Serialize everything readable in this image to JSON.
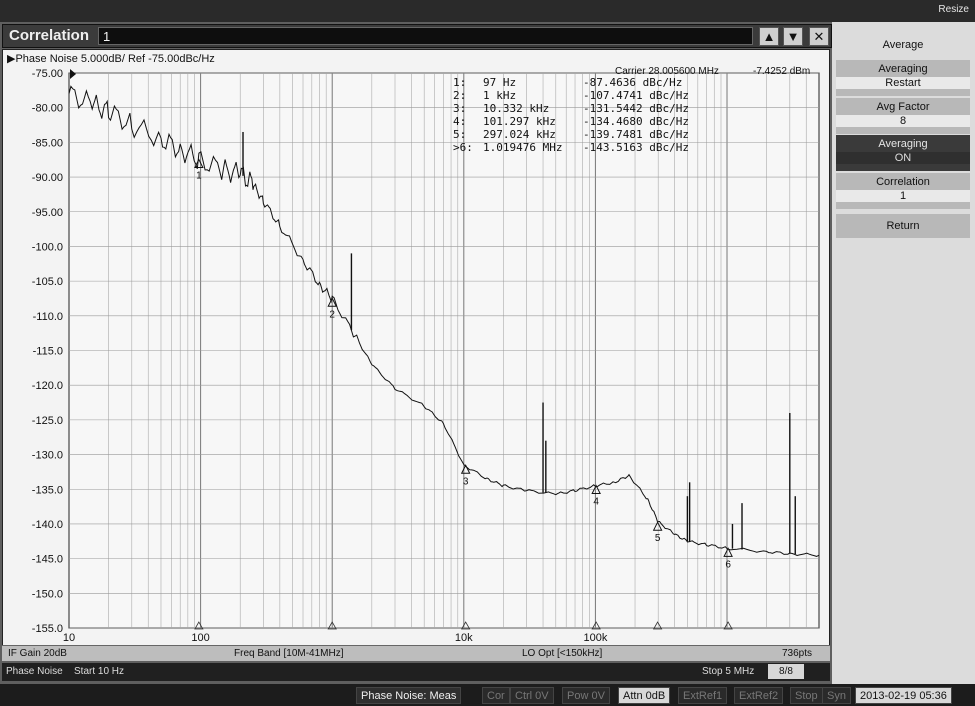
{
  "window": {
    "resize_label": "Resize",
    "title": "Correlation",
    "title_value": "1",
    "btn_up": "▲",
    "btn_down": "▼",
    "btn_close": "✕"
  },
  "plot_header": {
    "text": "▶Phase Noise 5.000dB/ Ref -75.00dBc/Hz",
    "carrier": "Carrier 28.005600 MHz",
    "carrier_power": "-7.4252 dBm"
  },
  "markers": [
    {
      "idx": "1:",
      "freq": "97 Hz",
      "value": "-87.4636 dBc/Hz"
    },
    {
      "idx": "2:",
      "freq": "1 kHz",
      "value": "-107.4741 dBc/Hz"
    },
    {
      "idx": "3:",
      "freq": "10.332 kHz",
      "value": "-131.5442 dBc/Hz"
    },
    {
      "idx": "4:",
      "freq": "101.297 kHz",
      "value": "-134.4680 dBc/Hz"
    },
    {
      "idx": "5:",
      "freq": "297.024 kHz",
      "value": "-139.7481 dBc/Hz"
    },
    {
      "idx": ">6:",
      "freq": "1.019476 MHz",
      "value": "-143.5163 dBc/Hz"
    }
  ],
  "chart_data": {
    "type": "line",
    "title": "",
    "xlabel": "",
    "ylabel": "",
    "x_scale": "log",
    "xlim": [
      10,
      5000000
    ],
    "ylim": [
      -155,
      -75
    ],
    "grid": true,
    "y_ticks": [
      "-75.00",
      "-80.00",
      "-85.00",
      "-90.00",
      "-95.00",
      "-100.0",
      "-105.0",
      "-110.0",
      "-115.0",
      "-120.0",
      "-125.0",
      "-130.0",
      "-135.0",
      "-140.0",
      "-145.0",
      "-150.0",
      "-155.0"
    ],
    "x_tick_labels": [
      {
        "x": 10,
        "label": "10"
      },
      {
        "x": 100,
        "label": "100"
      },
      {
        "x": 10000,
        "label": "10k"
      },
      {
        "x": 100000,
        "label": "100k"
      }
    ],
    "series": [
      {
        "values_x": [
          10,
          15,
          20,
          30,
          50,
          70,
          97,
          150,
          200,
          250,
          300,
          400,
          600,
          800,
          1000,
          1500,
          2000,
          3000,
          5000,
          7000,
          10000,
          15000,
          20000,
          30000,
          50000,
          70000,
          100000,
          140000,
          180000,
          250000,
          300000,
          400000,
          500000,
          700000,
          1000000,
          2000000,
          3000000,
          5000000
        ],
        "values_y": [
          -78,
          -79.5,
          -80.5,
          -82.5,
          -84.5,
          -86,
          -87.5,
          -89,
          -89.5,
          -91,
          -93.5,
          -97,
          -102,
          -105.5,
          -107.5,
          -113,
          -117,
          -120.5,
          -123,
          -125.5,
          -131.5,
          -133.5,
          -134.5,
          -135.2,
          -135.7,
          -135.2,
          -134.5,
          -134,
          -133,
          -136.5,
          -139.7,
          -141.5,
          -142.5,
          -143,
          -143.5,
          -144,
          -144.3,
          -144.5
        ]
      }
    ],
    "spurs": [
      {
        "x": 210,
        "y": -83.5
      },
      {
        "x": 1400,
        "y": -101
      },
      {
        "x": 40000,
        "y": -122.5
      },
      {
        "x": 42000,
        "y": -128
      },
      {
        "x": 500000,
        "y": -136
      },
      {
        "x": 520000,
        "y": -134
      },
      {
        "x": 1100000,
        "y": -140
      },
      {
        "x": 1300000,
        "y": -137
      },
      {
        "x": 3000000,
        "y": -124
      },
      {
        "x": 3300000,
        "y": -136
      }
    ],
    "marker_points": [
      {
        "label": "1",
        "x": 97,
        "y": -87.4636
      },
      {
        "label": "2",
        "x": 1000,
        "y": -107.4741
      },
      {
        "label": "3",
        "x": 10332,
        "y": -131.5442
      },
      {
        "label": "4",
        "x": 101297,
        "y": -134.468
      },
      {
        "label": "5",
        "x": 297024,
        "y": -139.7481
      },
      {
        "label": "6",
        "x": 1019476,
        "y": -143.5163
      }
    ]
  },
  "status": {
    "if_gain": "IF Gain 20dB",
    "freq_band": "Freq Band [10M-41MHz]",
    "lo_opt": "LO Opt [<150kHz]",
    "points": "736pts",
    "mode": "Phase Noise",
    "start": "Start 10 Hz",
    "stop": "Stop 5 MHz",
    "count": "8/8"
  },
  "bottom": {
    "meas": "Phase Noise: Meas",
    "cor": "Cor",
    "ctrl": "Ctrl 0V",
    "pow": "Pow 0V",
    "attn": "Attn 0dB",
    "extref1": "ExtRef1",
    "extref2": "ExtRef2",
    "stop": "Stop",
    "sync": "Syn",
    "datetime": "2013-02-19 05:36"
  },
  "softkeys": {
    "average": "Average",
    "averaging_restart_top": "Averaging",
    "averaging_restart_val": "Restart",
    "avg_factor_top": "Avg Factor",
    "avg_factor_val": "8",
    "averaging_top": "Averaging",
    "averaging_val": "ON",
    "correlation_top": "Correlation",
    "correlation_val": "1",
    "return": "Return"
  }
}
